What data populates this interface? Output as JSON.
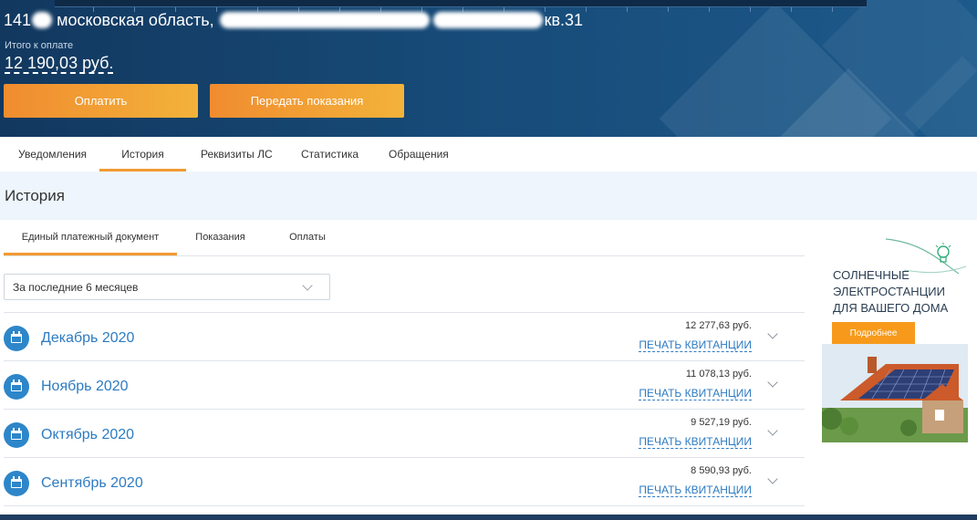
{
  "header": {
    "address_prefix": "141",
    "address_region": "московская область,",
    "address_suffix": "кв.31",
    "total_label": "Итого к оплате",
    "total_amount": "12 190,03 руб.",
    "pay_button": "Оплатить",
    "meter_button": "Передать показания"
  },
  "tabs": [
    {
      "label": "Уведомления"
    },
    {
      "label": "История"
    },
    {
      "label": "Реквизиты ЛС"
    },
    {
      "label": "Статистика"
    },
    {
      "label": "Обращения"
    }
  ],
  "active_tab": "История",
  "section_title": "История",
  "subtabs": [
    {
      "label": "Единый платежный документ"
    },
    {
      "label": "Показания"
    },
    {
      "label": "Оплаты"
    }
  ],
  "filter": {
    "value": "За последние 6 месяцев"
  },
  "months": [
    {
      "name": "Декабрь 2020",
      "amount": "12 277,63 руб.",
      "print": "ПЕЧАТЬ КВИТАНЦИИ",
      "icon": "calendar-icon"
    },
    {
      "name": "Ноябрь 2020",
      "amount": "11 078,13 руб.",
      "print": "ПЕЧАТЬ КВИТАНЦИИ",
      "icon": "calendar-icon"
    },
    {
      "name": "Октябрь 2020",
      "amount": "9 527,19 руб.",
      "print": "ПЕЧАТЬ КВИТАНЦИИ",
      "icon": "calendar-icon"
    },
    {
      "name": "Сентябрь 2020",
      "amount": "8 590,93 руб.",
      "print": "ПЕЧАТЬ КВИТАНЦИИ",
      "icon": "calendar-icon"
    }
  ],
  "ad": {
    "title_line1": "СОЛНЕЧНЫЕ",
    "title_line2": "ЭЛЕКТРОСТАНЦИИ",
    "title_line3": "ДЛЯ ВАШЕГО ДОМА",
    "button": "Подробнее"
  },
  "colors": {
    "accent_orange": "#f29a32",
    "link_blue": "#2d7bc2",
    "header_blue": "#174a77"
  }
}
